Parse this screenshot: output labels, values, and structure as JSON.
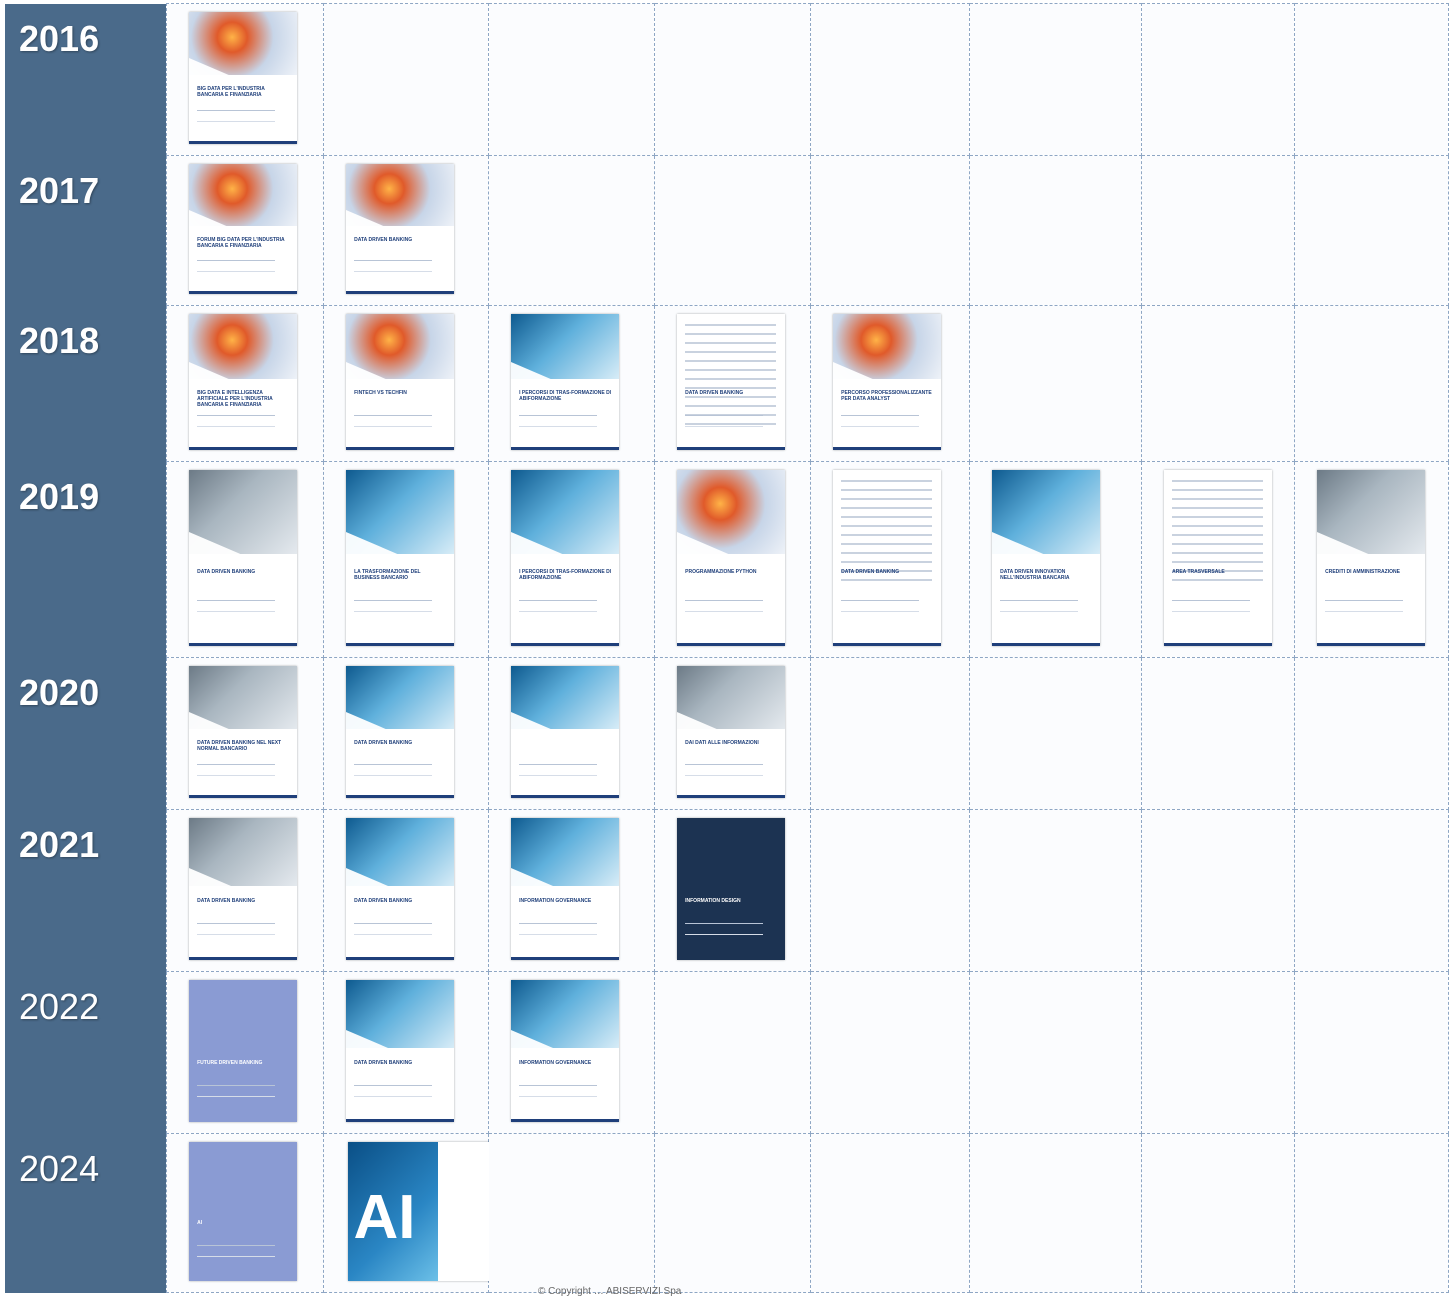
{
  "years": [
    "2016",
    "2017",
    "2018",
    "2019",
    "2020",
    "2021",
    "2022",
    "2024"
  ],
  "covers": {
    "2016": [
      {
        "title": "BIG DATA PER L'INDUSTRIA BANCARIA E FINANZIARIA",
        "style": "orb"
      }
    ],
    "2017": [
      {
        "title": "FORUM BIG DATA PER L'INDUSTRIA BANCARIA E FINANZIARIA",
        "style": "orb"
      },
      {
        "title": "DATA DRIVEN BANKING",
        "style": "orb"
      }
    ],
    "2018": [
      {
        "title": "BIG DATA E INTELLIGENZA ARTIFICIALE PER L'INDUSTRIA BANCARIA E FINANZIARIA",
        "style": "orb"
      },
      {
        "title": "FINTECH vs TECHFIN",
        "style": "orb"
      },
      {
        "title": "I percorsi di Tras-Formazione di ABIFormazione",
        "style": "blue"
      },
      {
        "title": "DATA DRIVEN BANKING",
        "style": "doc"
      },
      {
        "title": "PERCORSO PROFESSIONALIZZANTE PER DATA ANALYST",
        "style": "orb"
      }
    ],
    "2019": [
      {
        "title": "DATA DRIVEN BANKING",
        "style": "people"
      },
      {
        "title": "LA TRASFORMAZIONE DEL BUSINESS BANCARIO",
        "style": "blue"
      },
      {
        "title": "I percorsi di Tras-Formazione di ABIFormazione",
        "style": "blue"
      },
      {
        "title": "PROGRAMMAZIONE PYTHON",
        "style": "orb"
      },
      {
        "title": "DATA DRIVEN BANKING",
        "style": "doc"
      },
      {
        "title": "DATA DRIVEN INNOVATION NELL'INDUSTRIA BANCARIA",
        "style": "blue"
      },
      {
        "title": "AREA TRASVERSALE",
        "style": "doc"
      },
      {
        "title": "Crediti di Amministrazione",
        "style": "people"
      }
    ],
    "2020": [
      {
        "title": "DATA DRIVEN BANKING NEL NEXT NORMAL BANCARIO",
        "style": "people"
      },
      {
        "title": "DATA DRIVEN BANKING",
        "style": "blue"
      },
      {
        "title": "",
        "style": "blue"
      },
      {
        "title": "DAI DATI ALLE INFORMAZIONI",
        "style": "people"
      }
    ],
    "2021": [
      {
        "title": "DATA DRIVEN BANKING",
        "style": "people"
      },
      {
        "title": "DATA DRIVEN BANKING",
        "style": "blue"
      },
      {
        "title": "INFORMATION GOVERNANCE",
        "style": "blue"
      },
      {
        "title": "INFORMATION DESIGN",
        "style": "navy"
      }
    ],
    "2022": [
      {
        "title": "FUTURE DRIVEN BANKING",
        "style": "lav"
      },
      {
        "title": "DATA DRIVEN BANKING",
        "style": "blue"
      },
      {
        "title": "INFORMATION GOVERNANCE",
        "style": "blue"
      }
    ],
    "2024": [
      {
        "title": "AI",
        "style": "lav"
      },
      {
        "title": "AI",
        "style": "ai"
      }
    ]
  },
  "ai_cover": {
    "big": "AI"
  },
  "footer": "© Copyright … ABISERVIZI Spa"
}
